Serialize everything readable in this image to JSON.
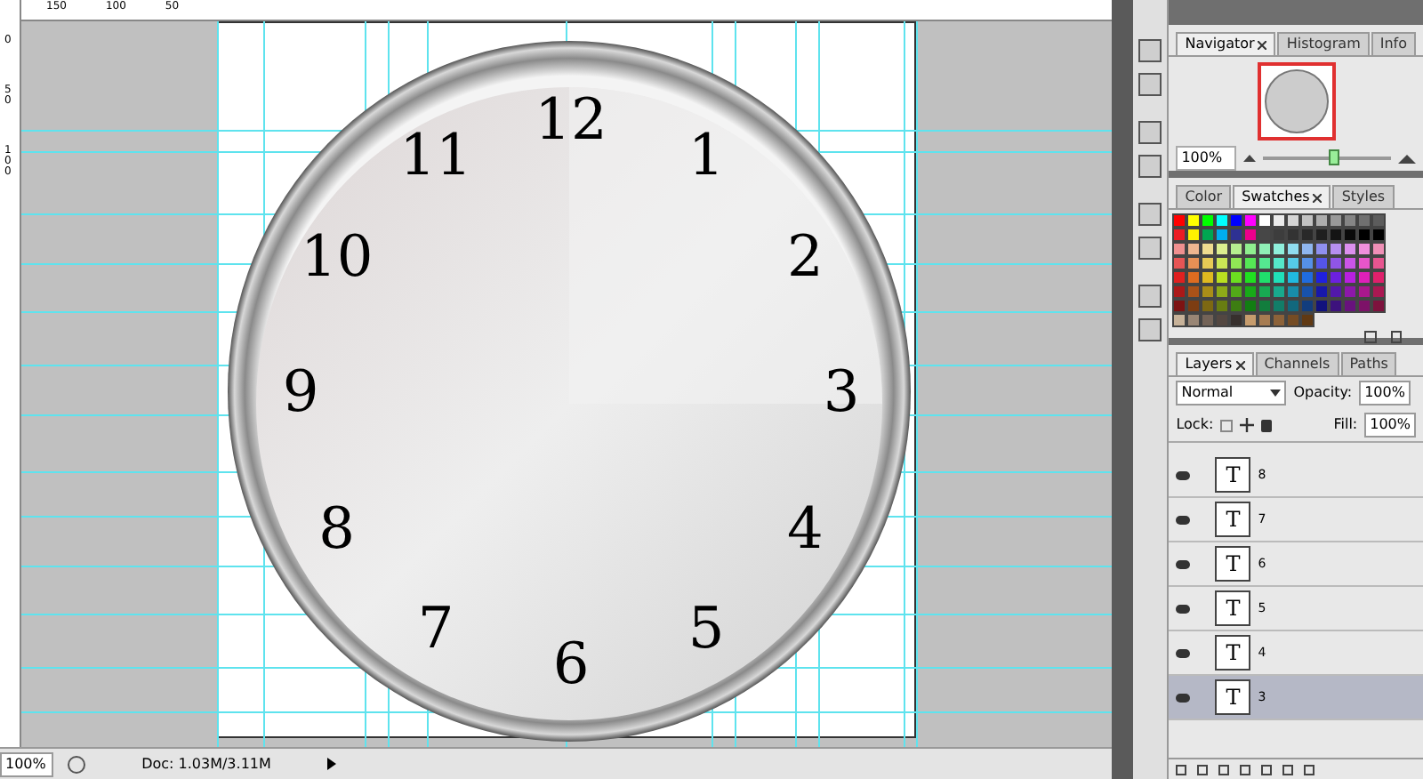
{
  "rulers": {
    "top_labels": [
      "150",
      "100",
      "50"
    ],
    "left_labels": [
      "0",
      "50",
      "100"
    ]
  },
  "clock": {
    "numerals": [
      "1",
      "2",
      "3",
      "4",
      "5",
      "6",
      "7",
      "8",
      "9",
      "10",
      "11",
      "12"
    ]
  },
  "status_bar": {
    "zoom": "100%",
    "doc": "Doc: 1.03M/3.11M"
  },
  "navigator": {
    "tabs": [
      {
        "label": "Navigator",
        "selected": true,
        "closable": true
      },
      {
        "label": "Histogram",
        "selected": false,
        "closable": false
      },
      {
        "label": "Info",
        "selected": false,
        "closable": false
      }
    ],
    "zoom": "100%",
    "level": 0.55
  },
  "swatches": {
    "tabs": [
      {
        "label": "Color",
        "selected": false,
        "closable": false
      },
      {
        "label": "Swatches",
        "selected": true,
        "closable": true
      },
      {
        "label": "Styles",
        "selected": false,
        "closable": false
      }
    ]
  },
  "layers": {
    "tabs": [
      {
        "label": "Layers",
        "selected": true,
        "closable": true
      },
      {
        "label": "Channels",
        "selected": false,
        "closable": false
      },
      {
        "label": "Paths",
        "selected": false,
        "closable": false
      }
    ],
    "blend_mode": "Normal",
    "opacity_label": "Opacity:",
    "opacity": "100%",
    "lock_label": "Lock:",
    "fill_label": "Fill:",
    "fill": "100%",
    "items": [
      {
        "thumbnail": "T",
        "name": "8",
        "selected": false
      },
      {
        "thumbnail": "T",
        "name": "7",
        "selected": false
      },
      {
        "thumbnail": "T",
        "name": "6",
        "selected": false
      },
      {
        "thumbnail": "T",
        "name": "5",
        "selected": false
      },
      {
        "thumbnail": "T",
        "name": "4",
        "selected": false
      },
      {
        "thumbnail": "T",
        "name": "3",
        "selected": true
      }
    ]
  }
}
